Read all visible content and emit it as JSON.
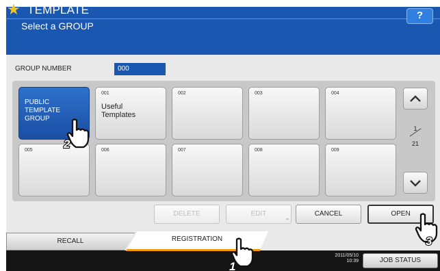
{
  "header": {
    "title": "TEMPLATE",
    "subtitle": "Select a GROUP",
    "help_label": "?"
  },
  "group_number": {
    "label": "GROUP NUMBER",
    "value": "000"
  },
  "tiles": [
    {
      "number": "",
      "name": "PUBLIC\nTEMPLATE\nGROUP",
      "selected": true
    },
    {
      "number": "001",
      "name": "Useful\nTemplates",
      "selected": false
    },
    {
      "number": "002",
      "name": "",
      "selected": false
    },
    {
      "number": "003",
      "name": "",
      "selected": false
    },
    {
      "number": "004",
      "name": "",
      "selected": false
    },
    {
      "number": "005",
      "name": "",
      "selected": false
    },
    {
      "number": "006",
      "name": "",
      "selected": false
    },
    {
      "number": "007",
      "name": "",
      "selected": false
    },
    {
      "number": "008",
      "name": "",
      "selected": false
    },
    {
      "number": "009",
      "name": "",
      "selected": false
    }
  ],
  "pager": {
    "current": "1",
    "total": "21"
  },
  "actions": {
    "delete_label": "DELETE",
    "edit_label": "EDIT",
    "cancel_label": "CANCEL",
    "open_label": "OPEN"
  },
  "tabs": {
    "recall_label": "RECALL",
    "registration_label": "REGISTRATION"
  },
  "status": {
    "date": "2011/05/10",
    "time": "10:39",
    "job_status_label": "JOB STATUS"
  },
  "callouts": [
    "1",
    "2",
    "3"
  ],
  "colors": {
    "header_blue": "#1a57b0",
    "accent_orange": "#f39a00",
    "star": "#f6c22a"
  }
}
